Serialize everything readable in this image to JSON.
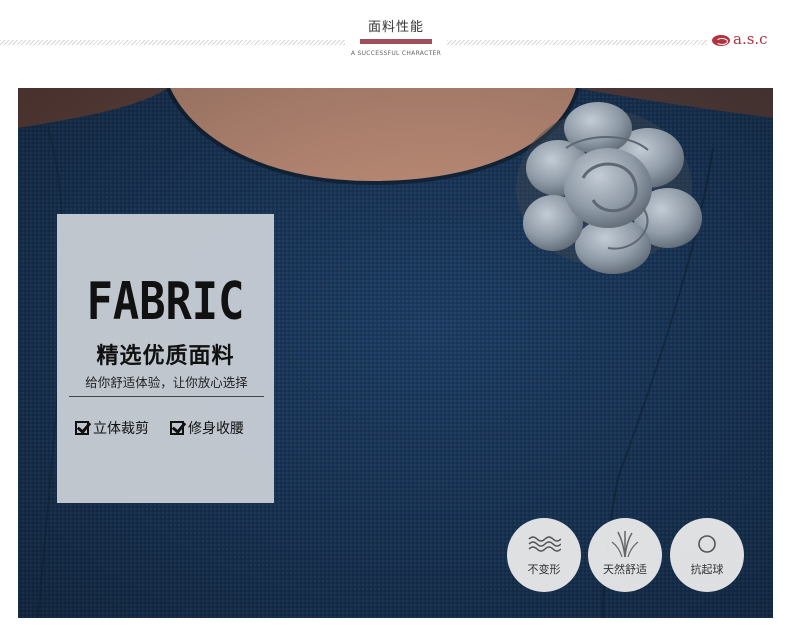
{
  "header": {
    "title": "面料性能",
    "subtitle": "A SUCCESSFUL CHARACTER",
    "logo_text": "a.s.c",
    "accent_color": "#a0505c",
    "logo_color": "#b2323e"
  },
  "photo": {
    "fabric_color": "#1c3a5e",
    "brooch_color": "#8e9aa6"
  },
  "panel": {
    "heading": "FABRIC",
    "title": "精选优质面料",
    "subtitle": "给你舒适体验，让你放心选择",
    "features": [
      {
        "label": "立体裁剪",
        "icon": "checkbox-icon"
      },
      {
        "label": "修身收腰",
        "icon": "checkbox-icon"
      }
    ]
  },
  "badges": [
    {
      "label": "不变形",
      "icon": "waves-icon"
    },
    {
      "label": "天然舒适",
      "icon": "grass-icon"
    },
    {
      "label": "抗起球",
      "icon": "circle-icon"
    }
  ]
}
